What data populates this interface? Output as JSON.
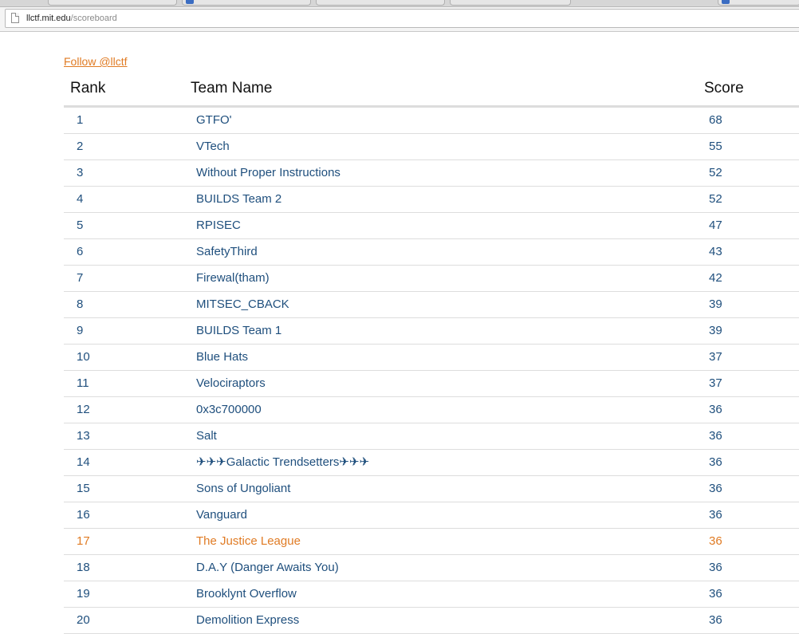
{
  "browser": {
    "url_host": "llctf.mit.edu",
    "url_path": "/scoreboard"
  },
  "follow_link": "Follow @llctf",
  "table": {
    "headers": {
      "rank": "Rank",
      "team": "Team Name",
      "score": "Score"
    },
    "highlight_color": "#e07b24",
    "link_color": "#1f4f7d",
    "rows": [
      {
        "rank": "1",
        "team": "GTFO'",
        "score": "68"
      },
      {
        "rank": "2",
        "team": "VTech",
        "score": "55"
      },
      {
        "rank": "3",
        "team": "Without Proper Instructions",
        "score": "52"
      },
      {
        "rank": "4",
        "team": "BUILDS Team 2",
        "score": "52"
      },
      {
        "rank": "5",
        "team": "RPISEC",
        "score": "47"
      },
      {
        "rank": "6",
        "team": "SafetyThird",
        "score": "43"
      },
      {
        "rank": "7",
        "team": "Firewal(tham)",
        "score": "42"
      },
      {
        "rank": "8",
        "team": "MITSEC_CBACK",
        "score": "39"
      },
      {
        "rank": "9",
        "team": "BUILDS Team 1",
        "score": "39"
      },
      {
        "rank": "10",
        "team": "Blue Hats",
        "score": "37"
      },
      {
        "rank": "11",
        "team": "Velociraptors",
        "score": "37"
      },
      {
        "rank": "12",
        "team": "0x3c700000",
        "score": "36"
      },
      {
        "rank": "13",
        "team": "Salt",
        "score": "36"
      },
      {
        "rank": "14",
        "team": "✈✈✈Galactic Trendsetters✈✈✈",
        "score": "36"
      },
      {
        "rank": "15",
        "team": "Sons of Ungoliant",
        "score": "36"
      },
      {
        "rank": "16",
        "team": "Vanguard",
        "score": "36"
      },
      {
        "rank": "17",
        "team": "The Justice League",
        "score": "36",
        "highlighted": true
      },
      {
        "rank": "18",
        "team": "D.A.Y (Danger Awaits You)",
        "score": "36"
      },
      {
        "rank": "19",
        "team": "Brooklynt Overflow",
        "score": "36"
      },
      {
        "rank": "20",
        "team": "Demolition Express",
        "score": "36"
      }
    ]
  }
}
